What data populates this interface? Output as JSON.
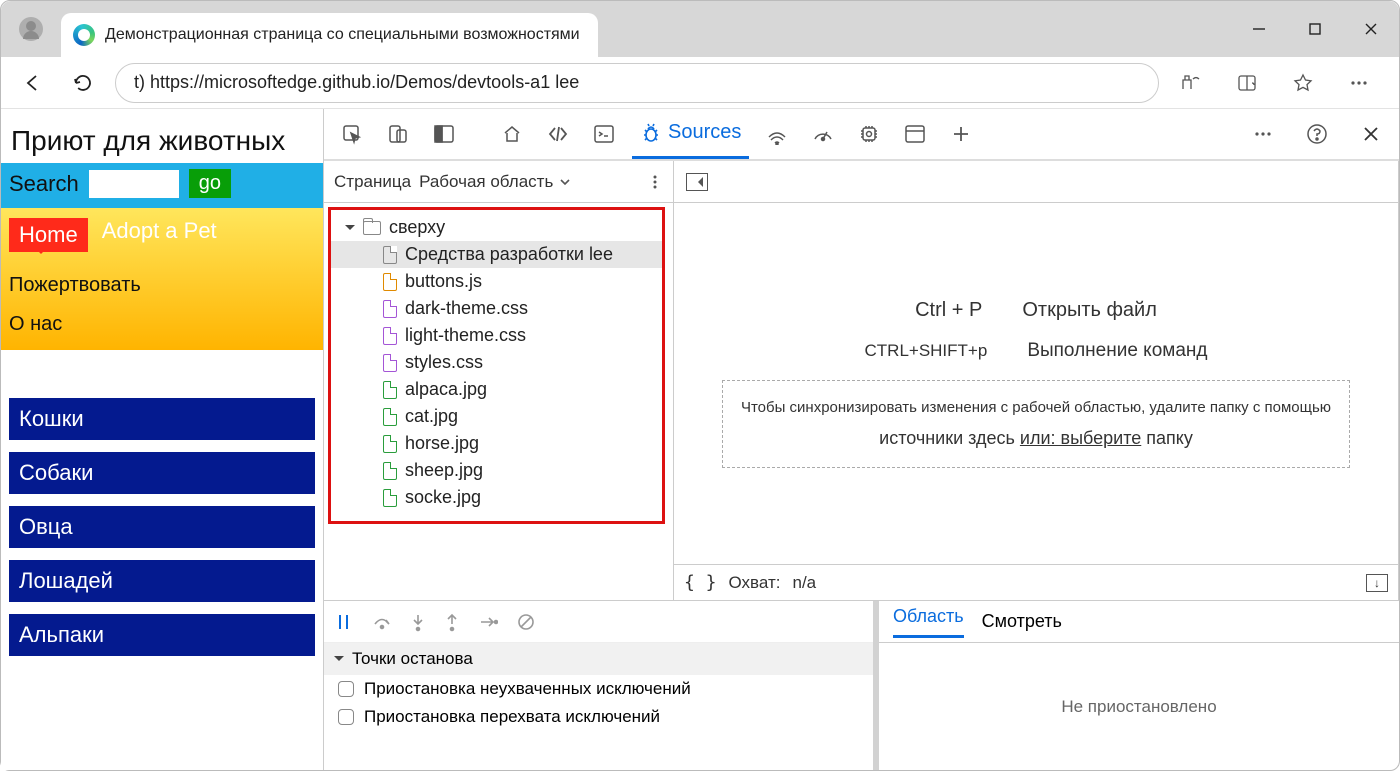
{
  "tab_title": "Демонстрационная страница со специальными возможностями",
  "url": "t) https://microsoftedge.github.io/Demos/devtools-a1 lee",
  "page": {
    "title": "Приют для животных",
    "search_label": "Search",
    "go": "go",
    "home": "Home",
    "adopt": "Adopt a Pet",
    "donate": "Пожертвовать",
    "about": "О нас",
    "cats": [
      "Кошки",
      "Собаки",
      "Овца",
      "Лошадей",
      "Альпаки"
    ]
  },
  "devtools": {
    "sources_label": "Sources",
    "nav": {
      "page": "Страница",
      "workspace": "Рабочая область"
    },
    "tree": {
      "top": "сверху",
      "index": "Средства разработки lee",
      "files": [
        {
          "n": "buttons.js",
          "c": "c-orange"
        },
        {
          "n": "dark-theme.css",
          "c": "c-purple"
        },
        {
          "n": "light-theme.css",
          "c": "c-purple"
        },
        {
          "n": "styles.css",
          "c": "c-purple"
        },
        {
          "n": "alpaca.jpg",
          "c": "c-green"
        },
        {
          "n": "cat.jpg",
          "c": "c-green"
        },
        {
          "n": "horse.jpg",
          "c": "c-green"
        },
        {
          "n": "sheep.jpg",
          "c": "c-green"
        },
        {
          "n": "socke.jpg",
          "c": "c-green"
        }
      ]
    },
    "editor": {
      "open_file_key": "Ctrl + P",
      "open_file": "Открыть файл",
      "run_cmd_key": "CTRL+SHIFT+p",
      "run_cmd": "Выполнение команд",
      "sync1": "Чтобы синхронизировать изменения с рабочей областью, удалите папку с помощью",
      "sync2_a": "источники здесь ",
      "sync2_b": "или: выберите",
      "sync2_c": " папку",
      "coverage_label": "Охват:",
      "coverage_val": "n/a"
    },
    "breakpoints": {
      "header": "Точки останова",
      "uncaught": "Приостановка неухваченных исключений",
      "caught": "Приостановка перехвата исключений"
    },
    "scope": {
      "scope": "Область",
      "watch": "Смотреть",
      "not_paused": "Не приостановлено"
    }
  }
}
